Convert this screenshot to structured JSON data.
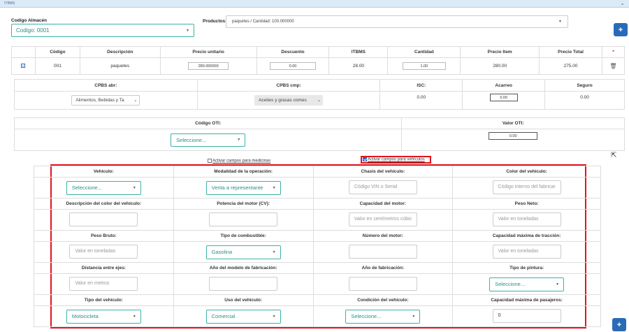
{
  "header": {
    "title": "ITBMS"
  },
  "almacen": {
    "label": "Codigo Almacén",
    "value": "Codigo: 0001"
  },
  "productos": {
    "label": "Productos:",
    "value": "paquetes / Cantidad: 100.000000"
  },
  "items_table": {
    "headers": [
      "Código",
      "Descripción",
      "Precio unitario",
      "Descuento",
      "ITBMS",
      "Cantidad",
      "Precio Item",
      "Precio Total",
      "*"
    ],
    "row": {
      "codigo": "001",
      "descripcion": "paquetes",
      "precio_unitario": "280.000000",
      "descuento": "0.00",
      "itbms": "28.00",
      "cantidad": "1.00",
      "precio_item": "280.00",
      "precio_total": "275.00"
    }
  },
  "cpbs": {
    "headers": [
      "CPBS abr:",
      "CPBS cmp:",
      "ISC:",
      "Acarreo",
      "Seguro"
    ],
    "abr_value": "Alimentos, Bebidas y Ta",
    "cmp_value": "Aceites y grasas comes",
    "isc": "0.00",
    "acarreo": "0.00",
    "seguro": "0.00"
  },
  "oti": {
    "codigo_label": "Código OTI:",
    "codigo_value": "Seleccione...",
    "valor_label": "Valor OTI:",
    "valor_value": "0.00"
  },
  "checks": {
    "medicinas": "Activar campos para medicinas",
    "vehiculos": "Activar campos para vehículos"
  },
  "vehicle": {
    "rows": [
      [
        {
          "label": "Vehículo:",
          "type": "select",
          "value": "Seleccione..."
        },
        {
          "label": "Modalidad de la operación:",
          "type": "select",
          "value": "Venta a representante"
        },
        {
          "label": "Chasis del vehículo:",
          "type": "input",
          "value": "Código VIN o Serial"
        },
        {
          "label": "Color del vehículo:",
          "type": "input",
          "value": "Código interno del fabricar"
        }
      ],
      [
        {
          "label": "Descripción del color del vehículo:",
          "type": "input",
          "value": ""
        },
        {
          "label": "Potencia del motor (CV):",
          "type": "input",
          "value": ""
        },
        {
          "label": "Capacidad del motor:",
          "type": "input",
          "value": "Valor en centímetros cúbic"
        },
        {
          "label": "Peso Neto:",
          "type": "input",
          "value": "Valor en toneladas"
        }
      ],
      [
        {
          "label": "Peso Bruto:",
          "type": "input",
          "value": "Valor en toneladas"
        },
        {
          "label": "Tipo de combustible:",
          "type": "select",
          "value": "Gasolina"
        },
        {
          "label": "Número del motor:",
          "type": "input",
          "value": ""
        },
        {
          "label": "Capacidad máxima de tracción:",
          "type": "input",
          "value": "Valor en toneladas"
        }
      ],
      [
        {
          "label": "Distancia entre ejes:",
          "type": "input",
          "value": "Valor en metros"
        },
        {
          "label": "Año del modelo de fabricación:",
          "type": "input",
          "value": ""
        },
        {
          "label": "Año de fabricación:",
          "type": "input",
          "value": ""
        },
        {
          "label": "Tipo de pintura:",
          "type": "select",
          "value": "Seleccione..."
        }
      ],
      [
        {
          "label": "Tipo del vehículo:",
          "type": "select",
          "value": "Motocicleta"
        },
        {
          "label": "Uso del vehículo:",
          "type": "select",
          "value": "Comercial"
        },
        {
          "label": "Condición del vehículo:",
          "type": "select",
          "value": "Seleccione..."
        },
        {
          "label": "Capacidad máxima de pasajeros:",
          "type": "input",
          "value": "0",
          "dark": true
        }
      ]
    ]
  },
  "colors": {
    "accent": "#3bb3a7",
    "primary": "#2a6bb8",
    "highlight": "#e0141e"
  }
}
